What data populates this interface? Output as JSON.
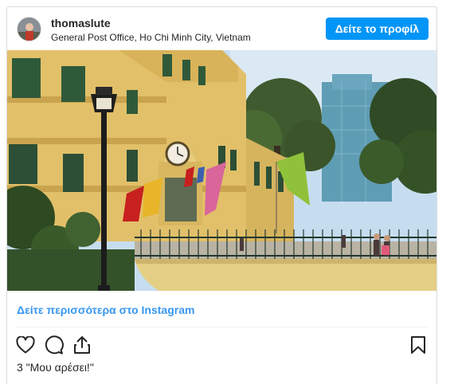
{
  "post": {
    "username": "thomaslute",
    "location": "General Post Office, Ho Chi Minh City, Vietnam",
    "profile_button": "Δείτε το προφίλ",
    "more_link": "Δείτε περισσότερα στο Instagram",
    "likes": "3 \"Μου αρέσει!\""
  },
  "icons": {
    "like": "heart-icon",
    "comment": "comment-icon",
    "share": "share-icon",
    "save": "bookmark-icon"
  },
  "colors": {
    "accent": "#0095f6",
    "link": "#3897f0",
    "text": "#262626",
    "border": "#dbdbdb"
  }
}
